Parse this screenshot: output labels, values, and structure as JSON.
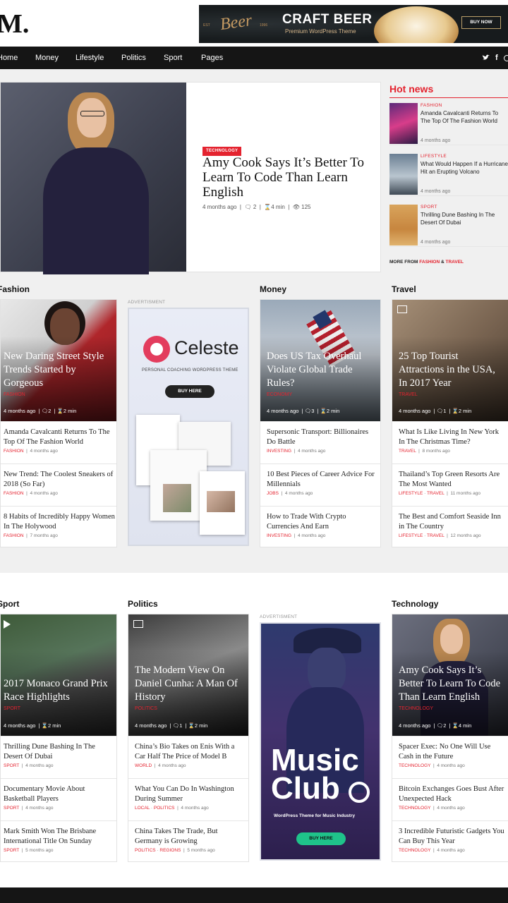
{
  "header": {
    "logo": "M.",
    "ad": {
      "script": "Beer",
      "est": "EST",
      "year": "1996",
      "title": "CRAFT BEER",
      "subtitle": "Premium WordPress Theme",
      "button": "BUY NOW"
    }
  },
  "nav": {
    "items": [
      "Home",
      "Money",
      "Lifestyle",
      "Politics",
      "Sport",
      "Pages"
    ],
    "social": [
      "twitter-icon",
      "facebook-icon",
      "other-icon"
    ]
  },
  "featured": {
    "badge": "TECHNOLOGY",
    "title": "Amy Cook Says It’s Better To Learn To Code Than Learn English",
    "time": "4 months ago",
    "comments": "2",
    "read": "4 min",
    "views": "125"
  },
  "hot_news": {
    "title": "Hot news",
    "items": [
      {
        "cat": "FASHION",
        "title": "Amanda Cavalcanti Returns To The Top Of The Fashion World",
        "time": "4 months ago"
      },
      {
        "cat": "LIFESTYLE",
        "title": "What Would Happen If a Hurricane Hit an Erupting Volcano",
        "time": "4 months ago"
      },
      {
        "cat": "SPORT",
        "title": "Thrilling Dune Bashing In The Desert Of Dubai",
        "time": "4 months ago"
      }
    ],
    "more_prefix": "MORE FROM",
    "more_cat1": "FASHION",
    "more_amp": "&",
    "more_cat2": "TRAVEL"
  },
  "ad_label": "ADVERTISMENT",
  "row1": {
    "fashion": {
      "title": "Fashion",
      "main": {
        "title": "New Daring Street Style Trends Started by Gorgeous",
        "cat": "FASHION",
        "time": "4 months ago",
        "comments": "2",
        "read": "2 min"
      },
      "items": [
        {
          "title": "Amanda Cavalcanti Returns To The Top Of The Fashion World",
          "cat": "FASHION",
          "time": "4 months ago"
        },
        {
          "title": "New Trend: The Coolest Sneakers of 2018 (So Far)",
          "cat": "FASHION",
          "time": "4 months ago"
        },
        {
          "title": "8 Habits of Incredibly Happy Women In The Holywood",
          "cat": "FASHION",
          "time": "7 months ago"
        }
      ]
    },
    "celeste": {
      "name": "Celeste",
      "tagline": "PERSONAL COACHING WORDPRESS THEME",
      "button": "BUY HERE"
    },
    "money": {
      "title": "Money",
      "main": {
        "title": "Does US Tax Overhaul Violate Global Trade Rules?",
        "cat": "ECONOMY",
        "time": "4 months ago",
        "comments": "3",
        "read": "2 min"
      },
      "items": [
        {
          "title": "Supersonic Transport: Billionaires Do Battle",
          "cat": "INVESTING",
          "time": "4 months ago"
        },
        {
          "title": "10 Best Pieces of Career Advice For Millennials",
          "cat": "JOBS",
          "time": "4 months ago"
        },
        {
          "title": "How to Trade With Crypto Currencies And Earn",
          "cat": "INVESTING",
          "time": "4 months ago"
        }
      ]
    },
    "travel": {
      "title": "Travel",
      "main": {
        "title": "25 Top Tourist Attractions in the USA, In 2017 Year",
        "cat": "TRAVEL",
        "time": "4 months ago",
        "comments": "1",
        "read": "2 min"
      },
      "items": [
        {
          "title": "What Is Like Living In New York In The Christmas Time?",
          "cat": "TRAVEL",
          "time": "8 months ago"
        },
        {
          "title": "Thailand’s Top Green Resorts Are The Most Wanted",
          "cat": "LIFESTYLE",
          "cat2": "TRAVEL",
          "time": "11 months ago"
        },
        {
          "title": "The Best and Comfort Seaside Inn in The Country",
          "cat": "LIFESTYLE",
          "cat2": "TRAVEL",
          "time": "12 months ago"
        }
      ]
    }
  },
  "row2": {
    "sport": {
      "title": "Sport",
      "main": {
        "title": "2017 Monaco Grand Prix Race Highlights",
        "cat": "SPORT",
        "time": "4 months ago",
        "read": "2 min"
      },
      "items": [
        {
          "title": "Thrilling Dune Bashing In The Desert Of Dubai",
          "cat": "SPORT",
          "time": "4 months ago"
        },
        {
          "title": "Documentary Movie About Basketball Players",
          "cat": "SPORT",
          "time": "4 months ago"
        },
        {
          "title": "Mark Smith Won The Brisbane International Title On Sunday",
          "cat": "SPORT",
          "time": "5 months ago"
        }
      ]
    },
    "politics": {
      "title": "Politics",
      "main": {
        "title": "The Modern View On Daniel Cunha: A Man Of History",
        "cat": "POLITICS",
        "time": "4 months ago",
        "comments": "1",
        "read": "2 min"
      },
      "items": [
        {
          "title": "China’s Bio Takes on Enis With a Car Half The Price of Model B",
          "cat": "WORLD",
          "time": "4 months ago"
        },
        {
          "title": "What You Can Do In Washington During Summer",
          "cat": "LOCAL",
          "cat2": "POLITICS",
          "time": "4 months ago"
        },
        {
          "title": "China Takes The Trade, But Germany is Growing",
          "cat": "POLITICS",
          "cat2": "REGIONS",
          "time": "5 months ago"
        }
      ]
    },
    "music": {
      "line1": "Music",
      "line2": "Club",
      "tagline": "WordPress Theme for Music Industry",
      "button": "BUY HERE"
    },
    "technology": {
      "title": "Technology",
      "main": {
        "title": "Amy Cook Says It’s Better To Learn To Code Than Learn English",
        "cat": "TECHNOLOGY",
        "time": "4 months ago",
        "comments": "2",
        "read": "4 min"
      },
      "items": [
        {
          "title": "Spacer Exec: No One Will Use Cash in the Future",
          "cat": "TECHNOLOGY",
          "time": "4 months ago"
        },
        {
          "title": "Bitcoin Exchanges Goes Bust After Unexpected Hack",
          "cat": "TECHNOLOGY",
          "time": "4 months ago"
        },
        {
          "title": "3 Incredible Futuristic Gadgets You Can Buy This Year",
          "cat": "TECHNOLOGY",
          "time": "4 months ago"
        }
      ]
    }
  },
  "colors": {
    "accent": "#e4232f",
    "nav_bg": "#151515",
    "page_bg": "#f0f0f0"
  }
}
